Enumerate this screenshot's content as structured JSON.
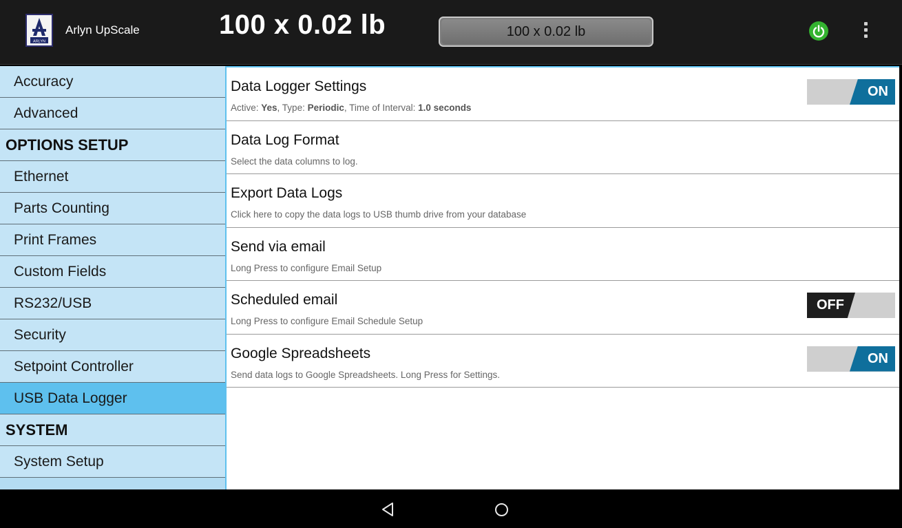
{
  "app": {
    "title": "Arlyn UpScale",
    "logo_text": "ARLYN"
  },
  "weight": {
    "display_large": "100 x 0.02 lb",
    "display_box": "100 x 0.02 lb"
  },
  "icons": {
    "power": "power-icon",
    "menu": "overflow-menu-icon",
    "back": "back-icon",
    "home": "home-icon",
    "logo": "arlyn-logo-icon"
  },
  "colors": {
    "sidebar_bg": "#c4e4f6",
    "selected_bg": "#5ec0ee",
    "toggle_on": "#0f6f9c",
    "toggle_off": "#1e1e1e",
    "power_green": "#34b330"
  },
  "sidebar": {
    "items": [
      {
        "label": "Accuracy",
        "type": "item"
      },
      {
        "label": "Advanced",
        "type": "item"
      },
      {
        "label": "OPTIONS SETUP",
        "type": "header"
      },
      {
        "label": "Ethernet",
        "type": "item"
      },
      {
        "label": "Parts Counting",
        "type": "item"
      },
      {
        "label": "Print Frames",
        "type": "item"
      },
      {
        "label": "Custom Fields",
        "type": "item"
      },
      {
        "label": "RS232/USB",
        "type": "item"
      },
      {
        "label": "Security",
        "type": "item"
      },
      {
        "label": "Setpoint Controller",
        "type": "item"
      },
      {
        "label": "USB Data Logger",
        "type": "item",
        "selected": true
      },
      {
        "label": "SYSTEM",
        "type": "header"
      },
      {
        "label": "System Setup",
        "type": "item"
      }
    ]
  },
  "settings": {
    "rows": [
      {
        "title": "Data Logger Settings",
        "summary": {
          "active_label": "Active: ",
          "active_value": "Yes",
          "type_label": ", Type: ",
          "type_value": "Periodic",
          "interval_label": ", Time of Interval: ",
          "interval_value": "1.0 seconds"
        },
        "toggle": "ON"
      },
      {
        "title": "Data Log Format",
        "subtitle": "Select the data columns to log."
      },
      {
        "title": "Export Data Logs",
        "subtitle": "Click here to copy the data logs to USB thumb drive from your database"
      },
      {
        "title": "Send via email",
        "subtitle": "Long Press to configure Email Setup"
      },
      {
        "title": "Scheduled email",
        "subtitle": "Long Press to configure Email Schedule Setup",
        "toggle": "OFF"
      },
      {
        "title": "Google Spreadsheets",
        "subtitle": "Send data logs to Google Spreadsheets. Long Press for Settings.",
        "toggle": "ON"
      }
    ]
  }
}
